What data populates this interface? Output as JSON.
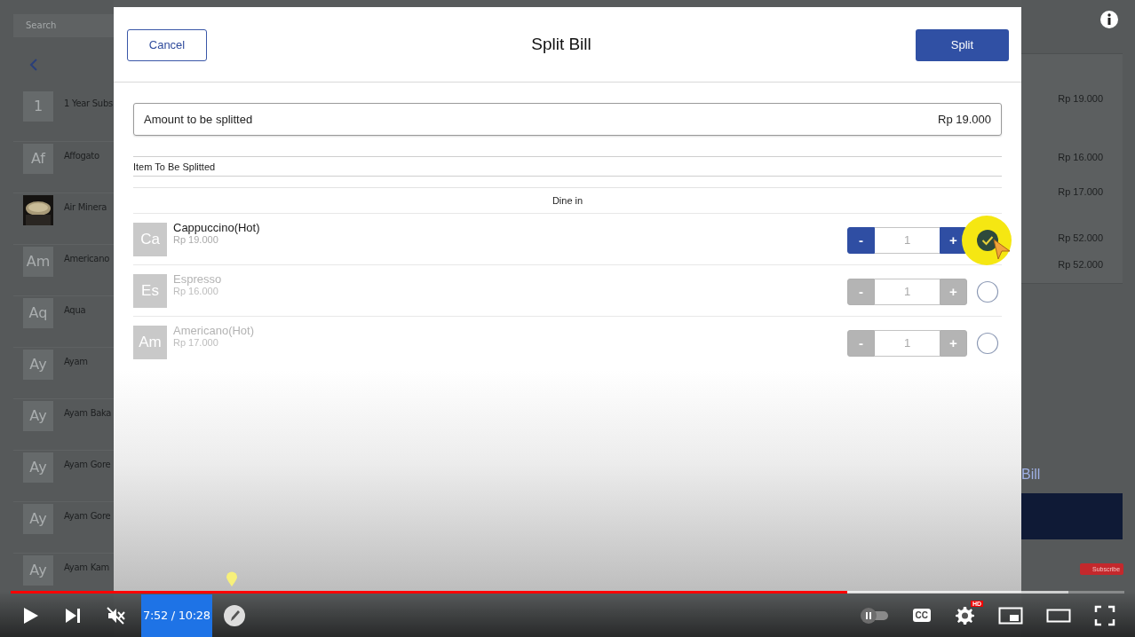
{
  "background_app": {
    "search": {
      "placeholder": "Search"
    },
    "products": [
      {
        "kind": "initials",
        "initials": "1",
        "name": "1 Year Subs"
      },
      {
        "kind": "initials",
        "initials": "Af",
        "name": "Affogato"
      },
      {
        "name": "Air Minera"
      },
      {
        "kind": "initials",
        "initials": "Am",
        "name": "Americano"
      },
      {
        "kind": "initials",
        "initials": "Aq",
        "name": "Aqua"
      },
      {
        "kind": "initials",
        "initials": "Ay",
        "name": "Ayam"
      },
      {
        "kind": "initials",
        "initials": "Ay",
        "name": "Ayam Baka"
      },
      {
        "kind": "initials",
        "initials": "Ay",
        "name": "Ayam Gore"
      },
      {
        "kind": "initials",
        "initials": "Ay",
        "name": "Ayam Gore"
      },
      {
        "kind": "initials",
        "initials": "Ay",
        "name": "Ayam Kam"
      }
    ],
    "prices": [
      "Rp 19.000",
      "Rp 16.000",
      "Rp 17.000",
      "Rp 52.000",
      "Rp 52.000"
    ],
    "bill_label": "Bill"
  },
  "dialog": {
    "cancel": "Cancel",
    "title": "Split Bill",
    "confirm": "Split",
    "amount_label": "Amount to be splitted",
    "amount": "Rp 19.000",
    "section_label": "Item To Be Splitted",
    "group": "Dine in",
    "items": [
      {
        "initials": "Ca",
        "name": "Cappuccino(Hot)",
        "price": "Rp 19.000",
        "decrement": "-",
        "quantity": "1",
        "increment": "+",
        "selected": true
      },
      {
        "initials": "Es",
        "name": "Espresso",
        "price": "Rp 16.000",
        "decrement": "-",
        "quantity": "1",
        "increment": "+",
        "selected": false
      },
      {
        "initials": "Am",
        "name": "Americano(Hot)",
        "price": "Rp 17.000",
        "decrement": "-",
        "quantity": "1",
        "increment": "+",
        "selected": false
      }
    ]
  },
  "player": {
    "progress": {
      "level": 0.751
    },
    "buffer": {
      "level": 0.95
    },
    "muted": true,
    "time": "7:52 / 10:28",
    "autoplay": {
      "on": false
    },
    "captions": "CC",
    "quality_badge": "HD",
    "subscribe": "Subscribe"
  }
}
